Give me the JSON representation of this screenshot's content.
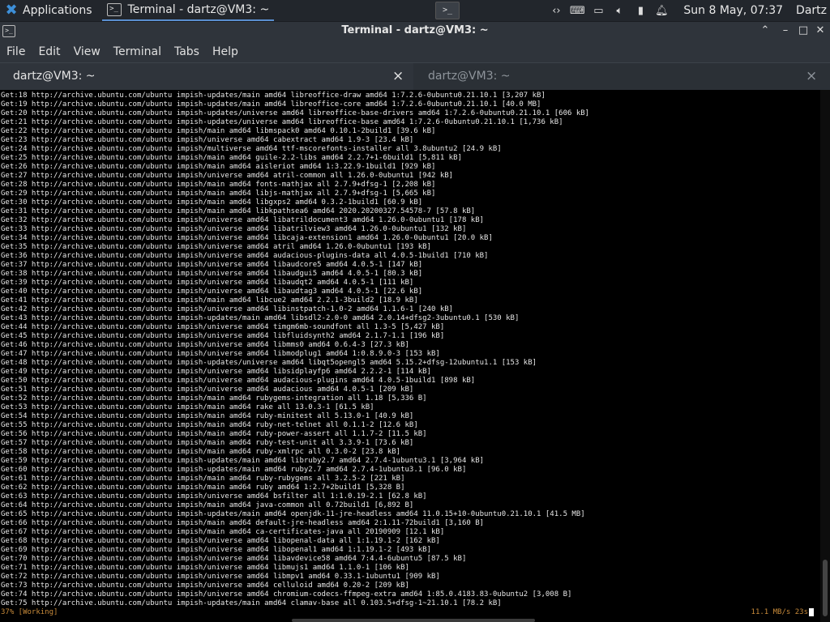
{
  "panel": {
    "applications_label": "Applications",
    "task_title": "Terminal - dartz@VM3: ~",
    "launcher_glyph": ">_",
    "clock": "Sun  8 May, 07:37",
    "user": "Dartz"
  },
  "window": {
    "title": "Terminal - dartz@VM3: ~"
  },
  "menu": {
    "file": "File",
    "edit": "Edit",
    "view": "View",
    "terminal": "Terminal",
    "tabs": "Tabs",
    "help": "Help"
  },
  "tabs": [
    {
      "label": "dartz@VM3: ~",
      "active": true
    },
    {
      "label": "dartz@VM3: ~",
      "active": false
    }
  ],
  "terminal": {
    "lines": [
      "Get:18 http://archive.ubuntu.com/ubuntu impish-updates/main amd64 libreoffice-draw amd64 1:7.2.6-0ubuntu0.21.10.1 [3,207 kB]",
      "Get:19 http://archive.ubuntu.com/ubuntu impish-updates/main amd64 libreoffice-core amd64 1:7.2.6-0ubuntu0.21.10.1 [40.0 MB]",
      "Get:20 http://archive.ubuntu.com/ubuntu impish-updates/universe amd64 libreoffice-base-drivers amd64 1:7.2.6-0ubuntu0.21.10.1 [606 kB]",
      "Get:21 http://archive.ubuntu.com/ubuntu impish-updates/universe amd64 libreoffice-base amd64 1:7.2.6-0ubuntu0.21.10.1 [1,736 kB]",
      "Get:22 http://archive.ubuntu.com/ubuntu impish/main amd64 libmspack0 amd64 0.10.1-2build1 [39.6 kB]",
      "Get:23 http://archive.ubuntu.com/ubuntu impish/universe amd64 cabextract amd64 1.9-3 [23.4 kB]",
      "Get:24 http://archive.ubuntu.com/ubuntu impish/multiverse amd64 ttf-mscorefonts-installer all 3.8ubuntu2 [24.9 kB]",
      "Get:25 http://archive.ubuntu.com/ubuntu impish/main amd64 guile-2.2-libs amd64 2.2.7+1-6build1 [5,811 kB]",
      "Get:26 http://archive.ubuntu.com/ubuntu impish/main amd64 aisleriot amd64 1:3.22.9-1build1 [929 kB]",
      "Get:27 http://archive.ubuntu.com/ubuntu impish/universe amd64 atril-common all 1.26.0-0ubuntu1 [942 kB]",
      "Get:28 http://archive.ubuntu.com/ubuntu impish/main amd64 fonts-mathjax all 2.7.9+dfsg-1 [2,208 kB]",
      "Get:29 http://archive.ubuntu.com/ubuntu impish/main amd64 libjs-mathjax all 2.7.9+dfsg-1 [5,665 kB]",
      "Get:30 http://archive.ubuntu.com/ubuntu impish/main amd64 libgxps2 amd64 0.3.2-1build1 [60.9 kB]",
      "Get:31 http://archive.ubuntu.com/ubuntu impish/main amd64 libkpathsea6 amd64 2020.20200327.54578-7 [57.8 kB]",
      "Get:32 http://archive.ubuntu.com/ubuntu impish/universe amd64 libatrildocument3 amd64 1.26.0-0ubuntu1 [178 kB]",
      "Get:33 http://archive.ubuntu.com/ubuntu impish/universe amd64 libatrilview3 amd64 1.26.0-0ubuntu1 [132 kB]",
      "Get:34 http://archive.ubuntu.com/ubuntu impish/universe amd64 libcaja-extension1 amd64 1.26.0-0ubuntu1 [20.0 kB]",
      "Get:35 http://archive.ubuntu.com/ubuntu impish/universe amd64 atril amd64 1.26.0-0ubuntu1 [193 kB]",
      "Get:36 http://archive.ubuntu.com/ubuntu impish/universe amd64 audacious-plugins-data all 4.0.5-1build1 [710 kB]",
      "Get:37 http://archive.ubuntu.com/ubuntu impish/universe amd64 libaudcore5 amd64 4.0.5-1 [147 kB]",
      "Get:38 http://archive.ubuntu.com/ubuntu impish/universe amd64 libaudgui5 amd64 4.0.5-1 [80.3 kB]",
      "Get:39 http://archive.ubuntu.com/ubuntu impish/universe amd64 libaudqt2 amd64 4.0.5-1 [111 kB]",
      "Get:40 http://archive.ubuntu.com/ubuntu impish/universe amd64 libaudtag3 amd64 4.0.5-1 [22.6 kB]",
      "Get:41 http://archive.ubuntu.com/ubuntu impish/main amd64 libcue2 amd64 2.2.1-3build2 [18.9 kB]",
      "Get:42 http://archive.ubuntu.com/ubuntu impish/universe amd64 libinstpatch-1.0-2 amd64 1.1.6-1 [240 kB]",
      "Get:43 http://archive.ubuntu.com/ubuntu impish-updates/main amd64 libsdl2-2.0-0 amd64 2.0.14+dfsg2-3ubuntu0.1 [530 kB]",
      "Get:44 http://archive.ubuntu.com/ubuntu impish/universe amd64 timgm6mb-soundfont all 1.3-5 [5,427 kB]",
      "Get:45 http://archive.ubuntu.com/ubuntu impish/universe amd64 libfluidsynth2 amd64 2.1.7-1.1 [196 kB]",
      "Get:46 http://archive.ubuntu.com/ubuntu impish/universe amd64 libmms0 amd64 0.6.4-3 [27.3 kB]",
      "Get:47 http://archive.ubuntu.com/ubuntu impish/universe amd64 libmodplug1 amd64 1:0.8.9.0-3 [153 kB]",
      "Get:48 http://archive.ubuntu.com/ubuntu impish-updates/universe amd64 libqt5opengl5 amd64 5.15.2+dfsg-12ubuntu1.1 [153 kB]",
      "Get:49 http://archive.ubuntu.com/ubuntu impish/universe amd64 libsidplayfp6 amd64 2.2.2-1 [114 kB]",
      "Get:50 http://archive.ubuntu.com/ubuntu impish/universe amd64 audacious-plugins amd64 4.0.5-1build1 [898 kB]",
      "Get:51 http://archive.ubuntu.com/ubuntu impish/universe amd64 audacious amd64 4.0.5-1 [209 kB]",
      "Get:52 http://archive.ubuntu.com/ubuntu impish/main amd64 rubygems-integration all 1.18 [5,336 B]",
      "Get:53 http://archive.ubuntu.com/ubuntu impish/main amd64 rake all 13.0.3-1 [61.5 kB]",
      "Get:54 http://archive.ubuntu.com/ubuntu impish/main amd64 ruby-minitest all 5.13.0-1 [40.9 kB]",
      "Get:55 http://archive.ubuntu.com/ubuntu impish/main amd64 ruby-net-telnet all 0.1.1-2 [12.6 kB]",
      "Get:56 http://archive.ubuntu.com/ubuntu impish/main amd64 ruby-power-assert all 1.1.7-2 [11.5 kB]",
      "Get:57 http://archive.ubuntu.com/ubuntu impish/main amd64 ruby-test-unit all 3.3.9-1 [73.6 kB]",
      "Get:58 http://archive.ubuntu.com/ubuntu impish/main amd64 ruby-xmlrpc all 0.3.0-2 [23.8 kB]",
      "Get:59 http://archive.ubuntu.com/ubuntu impish-updates/main amd64 libruby2.7 amd64 2.7.4-1ubuntu3.1 [3,964 kB]",
      "Get:60 http://archive.ubuntu.com/ubuntu impish-updates/main amd64 ruby2.7 amd64 2.7.4-1ubuntu3.1 [96.0 kB]",
      "Get:61 http://archive.ubuntu.com/ubuntu impish/main amd64 ruby-rubygems all 3.2.5-2 [221 kB]",
      "Get:62 http://archive.ubuntu.com/ubuntu impish/main amd64 ruby amd64 1:2.7+2build1 [5,328 B]",
      "Get:63 http://archive.ubuntu.com/ubuntu impish/universe amd64 bsfilter all 1:1.0.19-2.1 [62.8 kB]",
      "Get:64 http://archive.ubuntu.com/ubuntu impish/main amd64 java-common all 0.72build1 [6,892 B]",
      "Get:65 http://archive.ubuntu.com/ubuntu impish-updates/main amd64 openjdk-11-jre-headless amd64 11.0.15+10-0ubuntu0.21.10.1 [41.5 MB]",
      "Get:66 http://archive.ubuntu.com/ubuntu impish/main amd64 default-jre-headless amd64 2:1.11-72build1 [3,160 B]",
      "Get:67 http://archive.ubuntu.com/ubuntu impish/main amd64 ca-certificates-java all 20190909 [12.1 kB]",
      "Get:68 http://archive.ubuntu.com/ubuntu impish/universe amd64 libopenal-data all 1:1.19.1-2 [162 kB]",
      "Get:69 http://archive.ubuntu.com/ubuntu impish/universe amd64 libopenal1 amd64 1:1.19.1-2 [493 kB]",
      "Get:70 http://archive.ubuntu.com/ubuntu impish/universe amd64 libavdevice58 amd64 7:4.4-6ubuntu5 [87.5 kB]",
      "Get:71 http://archive.ubuntu.com/ubuntu impish/universe amd64 libmujs1 amd64 1.1.0-1 [106 kB]",
      "Get:72 http://archive.ubuntu.com/ubuntu impish/universe amd64 libmpv1 amd64 0.33.1-1ubuntu1 [909 kB]",
      "Get:73 http://archive.ubuntu.com/ubuntu impish/universe amd64 celluloid amd64 0.20-2 [209 kB]",
      "Get:74 http://archive.ubuntu.com/ubuntu impish/universe amd64 chromium-codecs-ffmpeg-extra amd64 1:85.0.4183.83-0ubuntu2 [3,008 B]",
      "Get:75 http://archive.ubuntu.com/ubuntu impish-updates/main amd64 clamav-base all 0.103.5+dfsg-1~21.10.1 [78.2 kB]"
    ],
    "status_left": "37% [Working]",
    "status_right": "11.1 MB/s 23s"
  }
}
